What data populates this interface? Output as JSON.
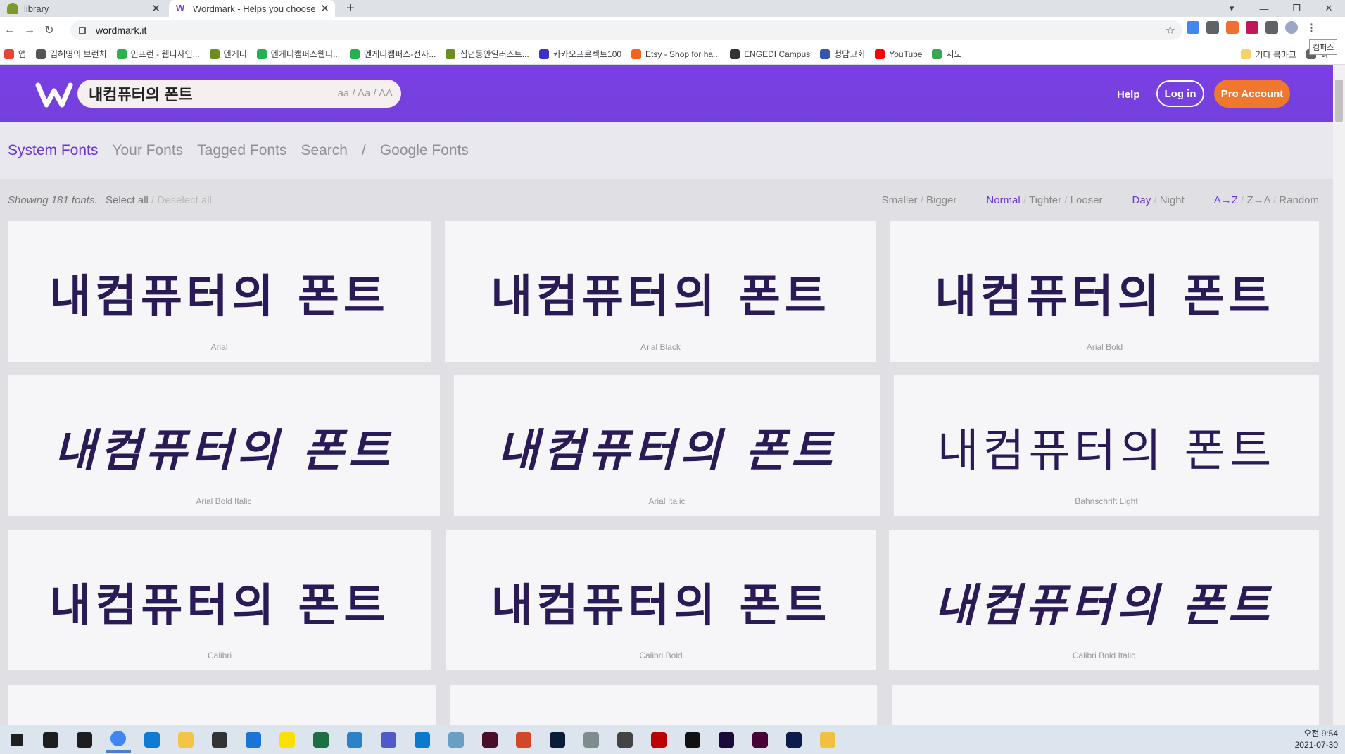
{
  "browser": {
    "tabs": [
      {
        "title": "library"
      },
      {
        "title": "Wordmark - Helps you choose"
      }
    ],
    "new_tab": "+",
    "url": "wordmark.it",
    "tooltip": "컴퍼스",
    "window_controls": [
      "—",
      "❐",
      "✕"
    ]
  },
  "bookmarks": {
    "items": [
      {
        "label": "앱",
        "color": "#ea4335"
      },
      {
        "label": "김혜영의 브런치",
        "color": "#555555"
      },
      {
        "label": "인프런 - 웹디자인...",
        "color": "#2bb24c"
      },
      {
        "label": "엔게디",
        "color": "#6b8e23"
      },
      {
        "label": "엔게디캠퍼스웹디...",
        "color": "#22b14c"
      },
      {
        "label": "엔게디캠퍼스-전자...",
        "color": "#22b14c"
      },
      {
        "label": "십년동안일러스트...",
        "color": "#6b8e23"
      },
      {
        "label": "카카오프로젝트100",
        "color": "#3b30c8"
      },
      {
        "label": "Etsy - Shop for ha...",
        "color": "#f1641e"
      },
      {
        "label": "ENGEDI Campus",
        "color": "#333333"
      },
      {
        "label": "청담교회",
        "color": "#3355aa"
      },
      {
        "label": "YouTube",
        "color": "#ff0000"
      },
      {
        "label": "지도",
        "color": "#34a853"
      }
    ],
    "other": "기타 북마크",
    "reading": "읽"
  },
  "header": {
    "search_text": "내컴퓨터의 폰트",
    "case_options": "aa / Aa / AA",
    "help": "Help",
    "login": "Log in",
    "pro": "Pro Account",
    "brand_color": "#7a3fe3",
    "accent_color": "#f0782e"
  },
  "font_nav": {
    "items": [
      "System Fonts",
      "Your Fonts",
      "Tagged Fonts",
      "Search",
      "/",
      "Google Fonts"
    ],
    "active": "System Fonts"
  },
  "options": {
    "showing_prefix": "Showing",
    "count": "181",
    "showing_suffix": "fonts.",
    "select_all": "Select all",
    "deselect_all": "Deselect all",
    "size": [
      "Smaller",
      "Bigger"
    ],
    "spacing": [
      "Normal",
      "Tighter",
      "Looser"
    ],
    "theme": [
      "Day",
      "Night"
    ],
    "sort": [
      "A→Z",
      "Z→A",
      "Random"
    ]
  },
  "sample_text": "내컴퓨터의 폰트",
  "fonts": [
    {
      "name": "Arial",
      "style": "bold"
    },
    {
      "name": "Arial Black",
      "style": "bold"
    },
    {
      "name": "Arial Bold",
      "style": "bold"
    },
    {
      "name": "Arial Bold Italic",
      "style": "italic"
    },
    {
      "name": "Arial Italic",
      "style": "italic"
    },
    {
      "name": "Bahnschrift Light",
      "style": "light"
    },
    {
      "name": "Calibri",
      "style": "bold"
    },
    {
      "name": "Calibri Bold",
      "style": "bold"
    },
    {
      "name": "Calibri Bold Italic",
      "style": "italic"
    },
    {
      "name": "",
      "style": "bold"
    },
    {
      "name": "",
      "style": "bold"
    },
    {
      "name": "",
      "style": "bold"
    }
  ],
  "clock": {
    "time": "오전 9:54",
    "date": "2021-07-30"
  },
  "taskbar_icons": [
    {
      "name": "start",
      "color": "#1e1e1e"
    },
    {
      "name": "search",
      "color": "#1e1e1e"
    },
    {
      "name": "task-view",
      "color": "#1e1e1e"
    },
    {
      "name": "chrome",
      "color": "#4285f4"
    },
    {
      "name": "edge",
      "color": "#0f7bd2"
    },
    {
      "name": "file-explorer",
      "color": "#f6c445"
    },
    {
      "name": "store",
      "color": "#333333"
    },
    {
      "name": "mail",
      "color": "#1b73d6"
    },
    {
      "name": "kakaotalk",
      "color": "#f9e000"
    },
    {
      "name": "excel",
      "color": "#1d7044"
    },
    {
      "name": "ie",
      "color": "#2c82c9"
    },
    {
      "name": "teams",
      "color": "#5059c9"
    },
    {
      "name": "vscode",
      "color": "#0a7acc"
    },
    {
      "name": "app",
      "color": "#6a9fc3"
    },
    {
      "name": "indesign",
      "color": "#4a0d2a"
    },
    {
      "name": "powerpoint",
      "color": "#d24726"
    },
    {
      "name": "photoshop",
      "color": "#0b1b3a"
    },
    {
      "name": "app2",
      "color": "#7f8c8d"
    },
    {
      "name": "calculator",
      "color": "#444444"
    },
    {
      "name": "filezilla",
      "color": "#bf0000"
    },
    {
      "name": "recorder",
      "color": "#111111"
    },
    {
      "name": "premiere",
      "color": "#1a0a3a"
    },
    {
      "name": "xd",
      "color": "#470137"
    },
    {
      "name": "audition",
      "color": "#0b1b4a"
    },
    {
      "name": "paint",
      "color": "#f0c040"
    }
  ]
}
